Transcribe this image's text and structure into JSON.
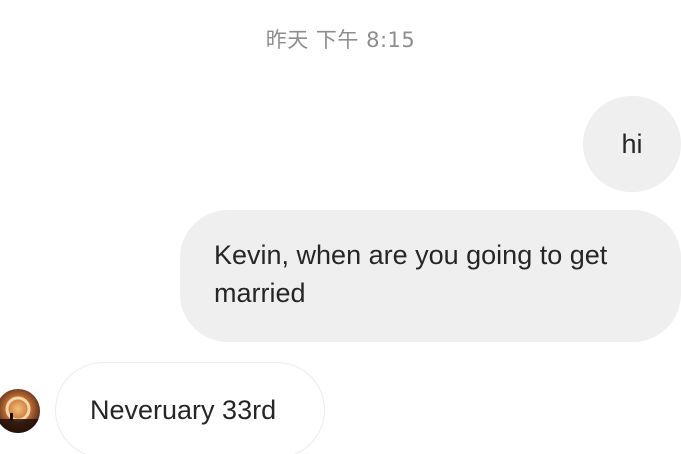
{
  "conversation": {
    "timestamp": "昨天 下午 8:15",
    "messages": [
      {
        "direction": "outgoing",
        "text": "hi"
      },
      {
        "direction": "outgoing",
        "text": "Kevin, when are you going to get married"
      },
      {
        "direction": "incoming",
        "text": "Neveruary 33rd"
      }
    ]
  },
  "colors": {
    "outgoing_bubble": "#efefef",
    "incoming_border": "#ececec",
    "timestamp_text": "#8e8e8e",
    "message_text": "#262626"
  },
  "icons": {
    "avatar": "contact-avatar-photo"
  }
}
